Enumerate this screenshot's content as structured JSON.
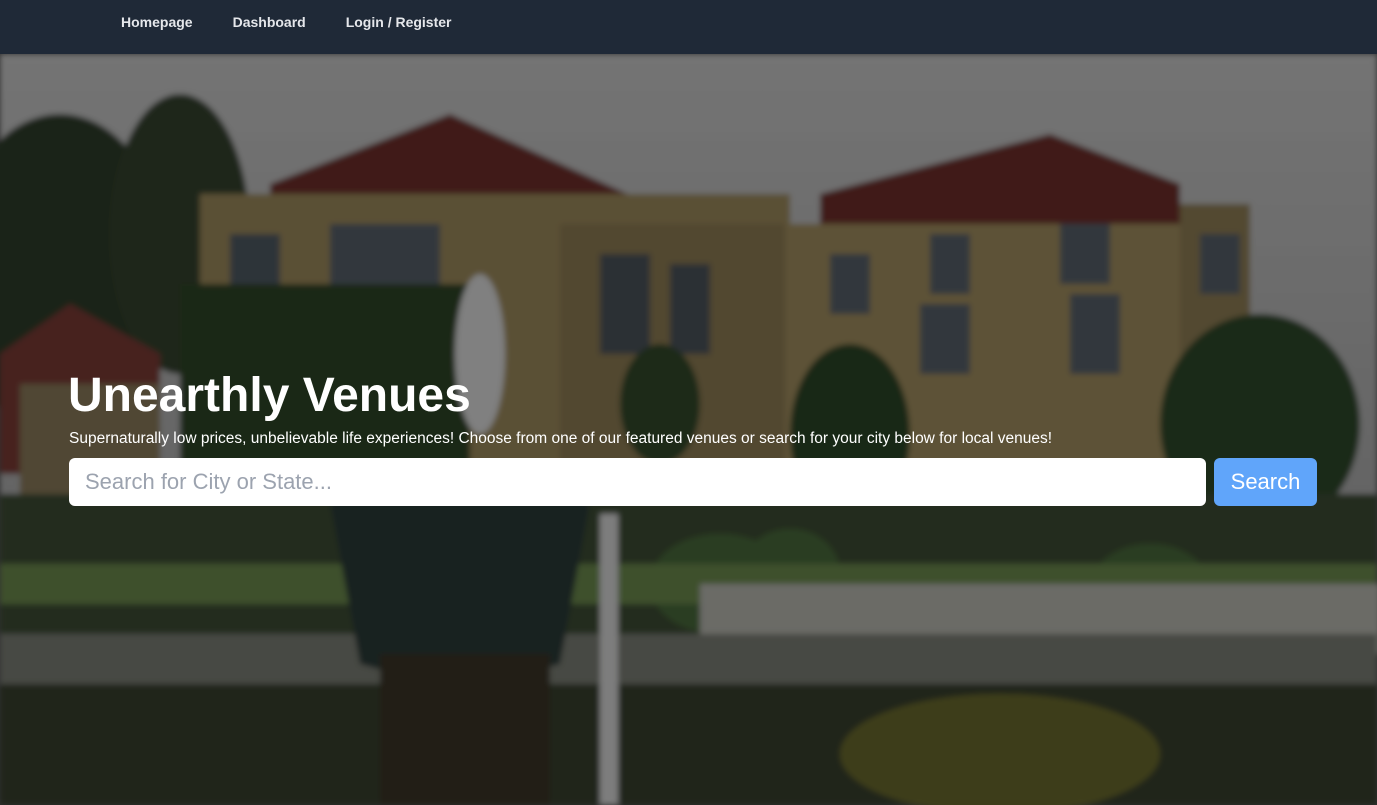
{
  "nav": {
    "links": [
      "Homepage",
      "Dashboard",
      "Login / Register"
    ]
  },
  "hero": {
    "title": "Unearthly Venues",
    "subtitle": "Supernaturally low prices, unbelievable life experiences! Choose from one of our featured venues or search for your city below for local venues!",
    "background_image": "blurred-manor-house-garden-photo"
  },
  "search": {
    "placeholder": "Search for City or State...",
    "value": "",
    "button_label": "Search"
  },
  "colors": {
    "navbar_bg": "#1f2937",
    "nav_text": "#e5e7eb",
    "button_bg": "#60a5fa",
    "input_bg": "#ffffff",
    "hero_text": "#ffffff"
  }
}
